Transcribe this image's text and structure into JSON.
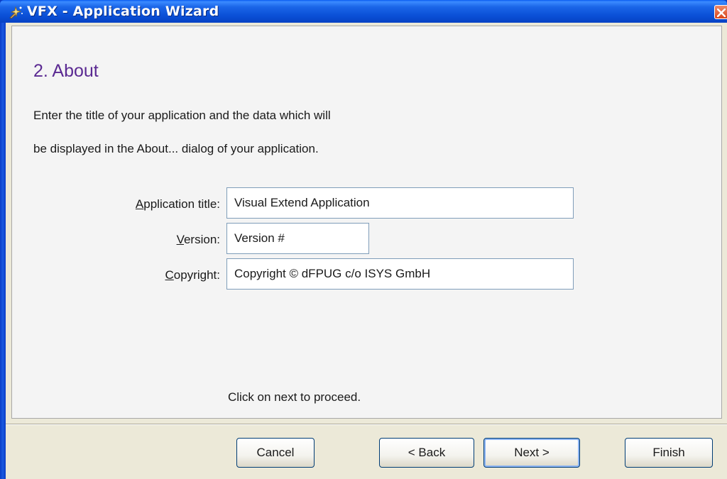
{
  "window": {
    "title": "VFX - Application Wizard"
  },
  "page": {
    "title": "2. About",
    "description_line1": "Enter the title of your application and the data which will",
    "description_line2": "be displayed in the About... dialog of your application.",
    "hint": "Click on next to proceed."
  },
  "fields": {
    "app_title": {
      "label": "Application title:",
      "mnemonic": "A",
      "value": "Visual Extend Application"
    },
    "version": {
      "label": "Version:",
      "mnemonic": "V",
      "value": "Version #"
    },
    "copyright": {
      "label": "Copyright:",
      "mnemonic": "C",
      "value": "Copyright © dFPUG c/o ISYS GmbH"
    }
  },
  "buttons": {
    "cancel": "Cancel",
    "back": "< Back",
    "next": "Next >",
    "finish": "Finish"
  },
  "icons": {
    "app": "wizard-app-icon",
    "close": "close-icon"
  },
  "colors": {
    "titlebar": "#0a4fd6",
    "page_title": "#5b2a92",
    "close": "#d8461c"
  }
}
